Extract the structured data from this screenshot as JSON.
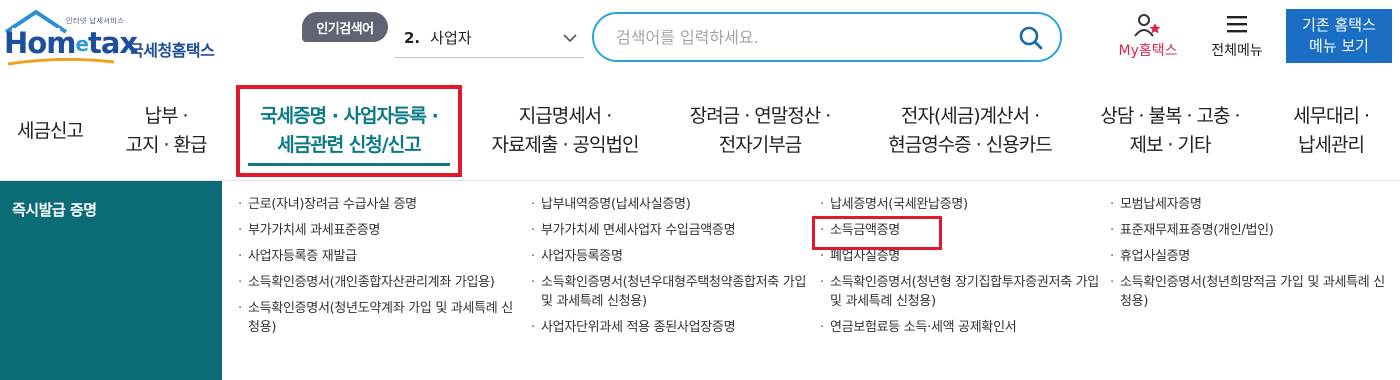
{
  "header": {
    "logo_tagline": "인터넷 납세서비스",
    "logo_home": "Hom",
    "logo_e": "e",
    "logo_tax": "tax",
    "logo_korean": "국세청홈택스",
    "popular_badge": "인기검색어",
    "popular_num": "2.",
    "popular_term": "사업자",
    "search_placeholder": "검색어를 입력하세요.",
    "my_hometax_my": "My",
    "my_hometax_rest": "홈택스",
    "all_menu": "전체메뉴",
    "legacy_line1": "기존 홈택스",
    "legacy_line2": "메뉴 보기"
  },
  "nav": {
    "items": [
      {
        "line1": "세금신고",
        "line2": ""
      },
      {
        "line1": "납부 ·",
        "line2": "고지 · 환급"
      },
      {
        "line1": "국세증명 · 사업자등록 ·",
        "line2": "세금관련 신청/신고"
      },
      {
        "line1": "지급명세서 ·",
        "line2": "자료제출 · 공익법인"
      },
      {
        "line1": "장려금 · 연말정산 ·",
        "line2": "전자기부금"
      },
      {
        "line1": "전자(세금)계산서 ·",
        "line2": "현금영수증 · 신용카드"
      },
      {
        "line1": "상담 · 불복 · 고충 ·",
        "line2": "제보 · 기타"
      },
      {
        "line1": "세무대리 ·",
        "line2": "납세관리"
      }
    ]
  },
  "submenu": {
    "title": "즉시발급 증명",
    "col1": [
      "근로(자녀)장려금 수급사실 증명",
      "부가가치세 과세표준증명",
      "사업자등록증 재발급",
      "소득확인증명서(개인종합자산관리계좌 가입용)",
      "소득확인증명서(청년도약계좌 가입 및 과세특례 신청용)"
    ],
    "col2": [
      "납부내역증명(납세사실증명)",
      "부가가치세 면세사업자 수입금액증명",
      "사업자등록증명",
      "소득확인증명서(청년우대형주택청약종합저축 가입 및 과세특례 신청용)",
      "사업자단위과세 적용 종된사업장증명"
    ],
    "col3": [
      "납세증명서(국세완납증명)",
      "소득금액증명",
      "폐업사실증명",
      "소득확인증명서(청년형 장기집합투자증권저축 가입 및 과세특례 신청용)",
      "연금보험료등 소득·세액 공제확인서"
    ],
    "col4": [
      "모범납세자증명",
      "표준재무제표증명(개인/법인)",
      "휴업사실증명",
      "소득확인증명서(청년희망적금 가입 및 과세특례 신청용)"
    ]
  },
  "colors": {
    "brand_blue": "#1e4f9c",
    "accent_teal": "#0a7b85",
    "sidebar_teal": "#0b6b77",
    "highlight_red": "#e2192b",
    "search_border": "#27a4d9",
    "legacy_button": "#1a6fc4"
  }
}
